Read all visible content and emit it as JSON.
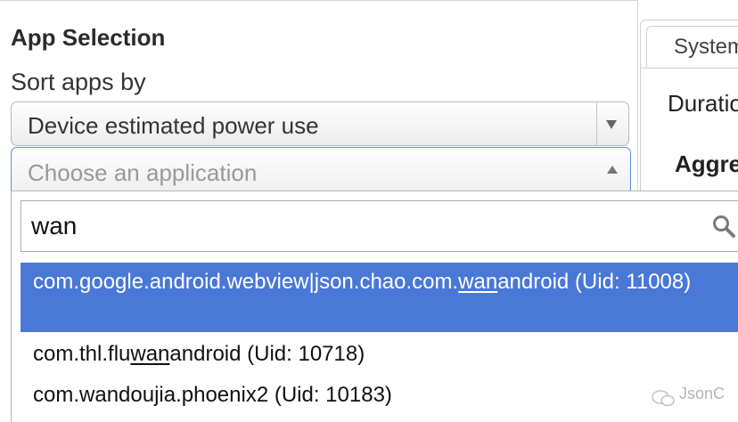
{
  "app_selection": {
    "title": "App Selection",
    "sort_label": "Sort apps by",
    "sort_selected": "Device estimated power use",
    "chooser_placeholder": "Choose an application"
  },
  "search": {
    "value": "wan"
  },
  "results": [
    {
      "pre": "com.google.android.webview|json.chao.com.",
      "match": "wan",
      "post": "android (Uid: 11008)",
      "highlighted": true
    },
    {
      "pre": "com.thl.flu",
      "match": "wan",
      "post": "android (Uid: 10718)",
      "highlighted": false
    },
    {
      "pre": "com.wandoujia.phoenix2 (Uid: 10183)",
      "match": "",
      "post": "",
      "highlighted": false
    }
  ],
  "right_panel": {
    "tab_label": "System",
    "duration_label": "Duratio",
    "aggregate_label": "Aggre"
  },
  "watermark": {
    "icon": "wechat-icon",
    "text": "JsonC"
  },
  "colors": {
    "highlight": "#4a78d6",
    "focus_border": "#5b8fd6"
  }
}
